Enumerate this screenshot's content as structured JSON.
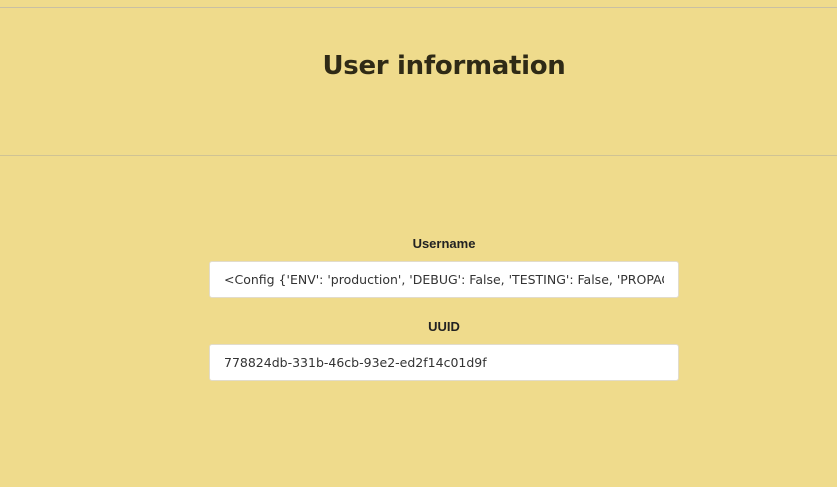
{
  "header": {
    "title": "User information"
  },
  "form": {
    "username": {
      "label": "Username",
      "value": "<Config {'ENV': 'production', 'DEBUG': False, 'TESTING': False, 'PROPAG"
    },
    "uuid": {
      "label": "UUID",
      "value": "778824db-331b-46cb-93e2-ed2f14c01d9f"
    }
  },
  "colors": {
    "background": "#efdb8c",
    "input_background": "#ffffff",
    "title_text": "#2f2a16"
  }
}
